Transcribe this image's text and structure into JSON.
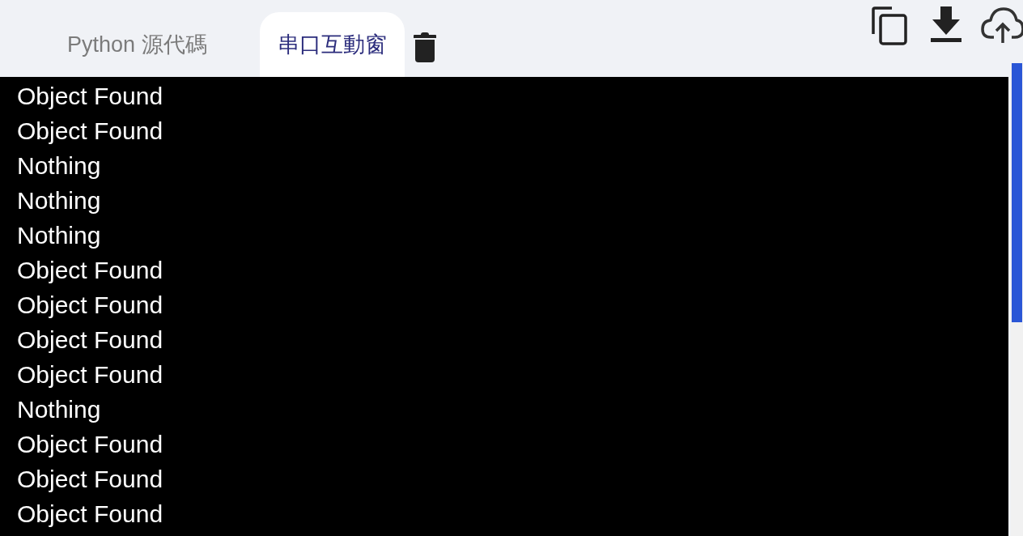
{
  "tabs": [
    {
      "label": "Python 源代碼",
      "selected": false
    },
    {
      "label": "串口互動窗",
      "selected": true
    }
  ],
  "console": {
    "lines": [
      "Object Found",
      "Object Found",
      "Nothing",
      "Nothing",
      "Nothing",
      "Object Found",
      "Object Found",
      "Object Found",
      "Object Found",
      "Nothing",
      "Object Found",
      "Object Found",
      "Object Found"
    ]
  }
}
